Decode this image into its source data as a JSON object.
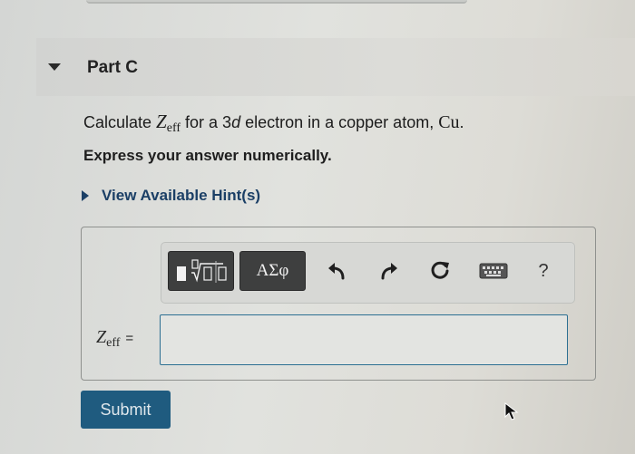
{
  "part": {
    "title": "Part C",
    "expanded": true
  },
  "question": {
    "prefix": "Calculate ",
    "z_symbol": "Z",
    "z_subscript": "eff",
    "middle": " for a 3",
    "orbital": "d",
    "after_orbital": " electron in a copper atom, ",
    "element_symbol": "Cu",
    "suffix": "."
  },
  "instruction": "Express your answer numerically.",
  "hint": {
    "label": "View Available Hint(s)"
  },
  "toolbar": {
    "templates_icon": "templates-icon",
    "symbols_label": "ΑΣφ",
    "undo_icon": "undo-arrow-icon",
    "redo_icon": "redo-arrow-icon",
    "reset_icon": "reset-icon",
    "keyboard_icon": "keyboard-icon",
    "help_label": "?"
  },
  "answer": {
    "label_symbol": "Z",
    "label_subscript": "eff",
    "equals": "=",
    "value": ""
  },
  "submit": {
    "label": "Submit"
  },
  "colors": {
    "link": "#1b3f66",
    "submit_bg": "#1f5b7f",
    "input_border": "#2c6f92",
    "toolbar_dark": "#3e3f3f"
  }
}
